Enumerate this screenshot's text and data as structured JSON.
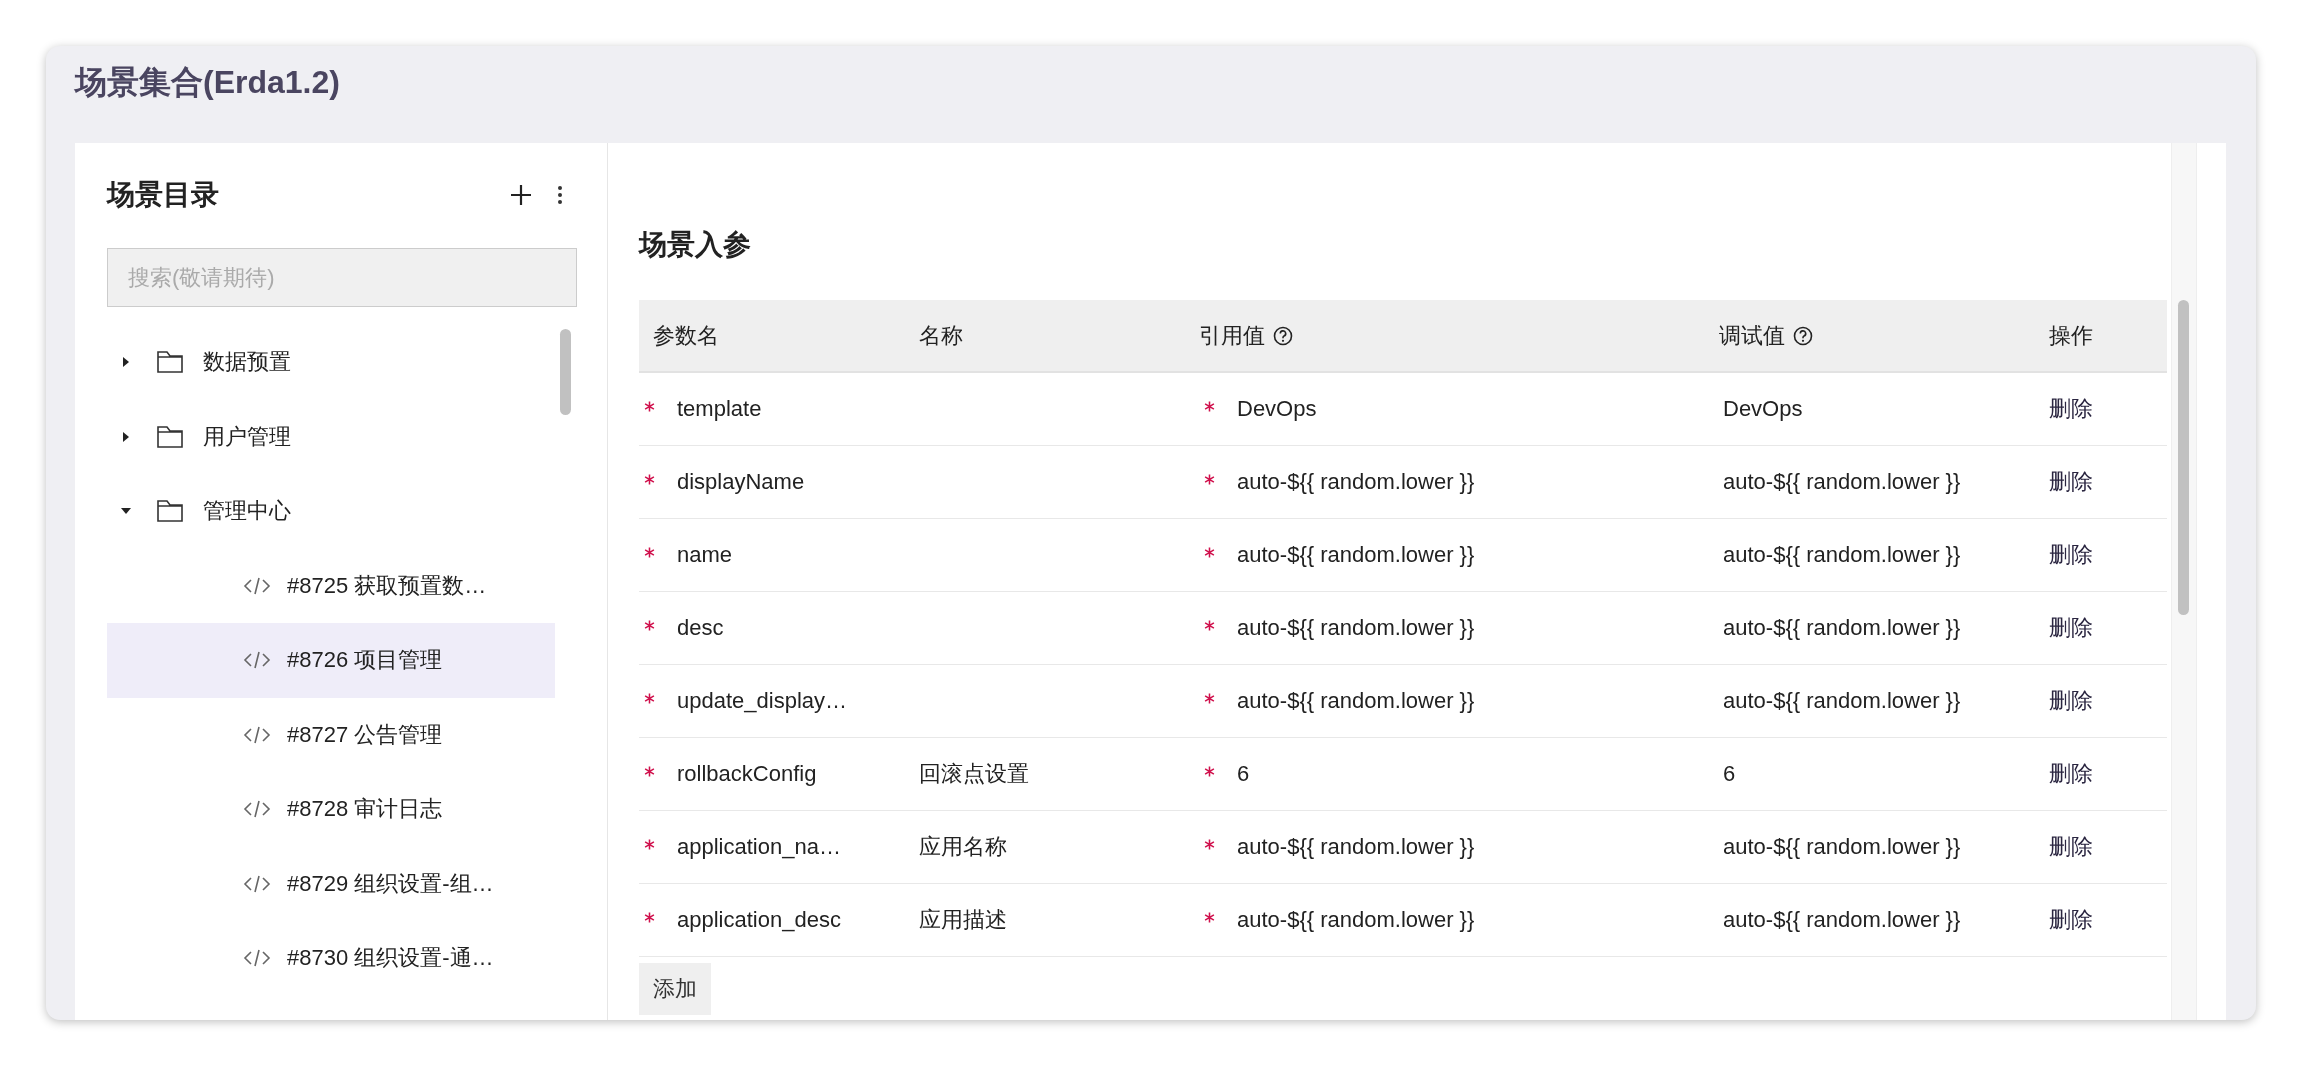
{
  "window": {
    "title": "场景集合(Erda1.2)"
  },
  "sidebar": {
    "title": "场景目录",
    "search": {
      "placeholder": "搜索(敬请期待)"
    },
    "tree": [
      {
        "label": "数据预置",
        "kind": "folder",
        "expanded": false,
        "selected": false
      },
      {
        "label": "用户管理",
        "kind": "folder",
        "expanded": false,
        "selected": false
      },
      {
        "label": "管理中心",
        "kind": "folder",
        "expanded": true,
        "selected": false,
        "children": [
          {
            "label": "#8725 获取预置数…",
            "kind": "scene",
            "selected": false
          },
          {
            "label": "#8726 项目管理",
            "kind": "scene",
            "selected": true
          },
          {
            "label": "#8727 公告管理",
            "kind": "scene",
            "selected": false
          },
          {
            "label": "#8728 审计日志",
            "kind": "scene",
            "selected": false
          },
          {
            "label": "#8729 组织设置-组…",
            "kind": "scene",
            "selected": false
          },
          {
            "label": "#8730 组织设置-通…",
            "kind": "scene",
            "selected": false
          }
        ]
      }
    ]
  },
  "params": {
    "title": "场景入参",
    "columns": [
      {
        "label": "参数名",
        "help": false
      },
      {
        "label": "名称",
        "help": false
      },
      {
        "label": "引用值",
        "help": true
      },
      {
        "label": "调试值",
        "help": true
      },
      {
        "label": "操作",
        "help": false
      }
    ],
    "rows": [
      {
        "name": "template",
        "name_required": true,
        "reference": "DevOps",
        "reference_required": true,
        "debug": "DevOps",
        "action": "删除"
      },
      {
        "name": "displayName",
        "name_required": true,
        "reference": "auto-${{ random.lower }}",
        "reference_required": true,
        "debug": "auto-${{ random.lower }}",
        "action": "删除"
      },
      {
        "name": "name",
        "name_required": true,
        "reference": "auto-${{ random.lower }}",
        "reference_required": true,
        "debug": "auto-${{ random.lower }}",
        "action": "删除"
      },
      {
        "name": "desc",
        "name_required": true,
        "reference": "auto-${{ random.lower }}",
        "reference_required": true,
        "debug": "auto-${{ random.lower }}",
        "action": "删除"
      },
      {
        "name": "update_display…",
        "name_required": true,
        "reference": "auto-${{ random.lower }}",
        "reference_required": true,
        "debug": "auto-${{ random.lower }}",
        "action": "删除"
      },
      {
        "name": "rollbackConfig",
        "name_required": true,
        "label": "回滚点设置",
        "reference": "6",
        "reference_required": true,
        "debug": "6",
        "action": "删除"
      },
      {
        "name": "application_na…",
        "name_required": true,
        "label": "应用名称",
        "reference": "auto-${{ random.lower }}",
        "reference_required": true,
        "debug": "auto-${{ random.lower }}",
        "action": "删除"
      },
      {
        "name": "application_desc",
        "name_required": true,
        "label": "应用描述",
        "reference": "auto-${{ random.lower }}",
        "reference_required": true,
        "debug": "auto-${{ random.lower }}",
        "action": "删除"
      }
    ],
    "add_button": "添加"
  }
}
